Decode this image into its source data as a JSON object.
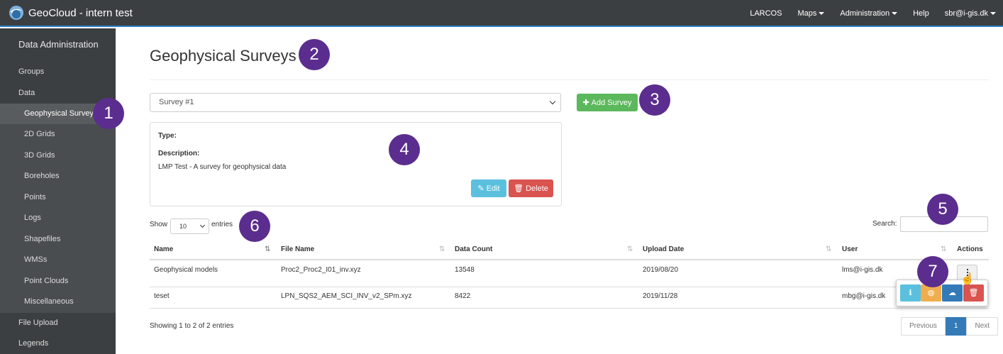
{
  "app": {
    "title": "GeoCloud - intern test"
  },
  "nav": {
    "larcos": "LARCOS",
    "maps": "Maps",
    "administration": "Administration",
    "help": "Help",
    "user": "sbr@i-gis.dk"
  },
  "sidebar": {
    "title": "Data Administration",
    "items": [
      {
        "label": "Groups"
      },
      {
        "label": "Data"
      },
      {
        "label": "Geophysical Surveys"
      },
      {
        "label": "2D Grids"
      },
      {
        "label": "3D Grids"
      },
      {
        "label": "Boreholes"
      },
      {
        "label": "Points"
      },
      {
        "label": "Logs"
      },
      {
        "label": "Shapefiles"
      },
      {
        "label": "WMSs"
      },
      {
        "label": "Point Clouds"
      },
      {
        "label": "Miscellaneous"
      },
      {
        "label": "File Upload"
      },
      {
        "label": "Legends"
      }
    ]
  },
  "page": {
    "title": "Geophysical Surveys"
  },
  "survey": {
    "selected": "Survey #1",
    "add_label": "Add Survey",
    "type_label": "Type:",
    "description_label": "Description:",
    "description": "LMP Test - A survey for geophysical data",
    "edit_label": "Edit",
    "delete_label": "Delete"
  },
  "table": {
    "show_label": "Show",
    "page_size": "10",
    "entries_label": "entries",
    "search_label": "Search:",
    "columns": [
      "Name",
      "File Name",
      "Data Count",
      "Upload Date",
      "User",
      "Actions"
    ],
    "rows": [
      {
        "name": "Geophysical models",
        "file": "Proc2_Proc2_I01_inv.xyz",
        "count": "13548",
        "date": "2019/08/20",
        "user": "lms@i-gis.dk"
      },
      {
        "name": "teset",
        "file": "LPN_SQS2_AEM_SCI_INV_v2_SPm.xyz",
        "count": "8422",
        "date": "2019/11/28",
        "user": "mbg@i-gis.dk"
      }
    ],
    "info": "Showing 1 to 2 of 2 entries",
    "pager": {
      "previous": "Previous",
      "current": "1",
      "next": "Next"
    }
  },
  "annotations": [
    "1",
    "2",
    "3",
    "4",
    "5",
    "6",
    "7"
  ],
  "colors": {
    "navbar": "#3c3f41",
    "success": "#5cb85c",
    "info": "#5bc0de",
    "danger": "#d9534f",
    "warning": "#f0ad4e",
    "primary": "#337ab7",
    "badge": "#5b2d8e"
  }
}
